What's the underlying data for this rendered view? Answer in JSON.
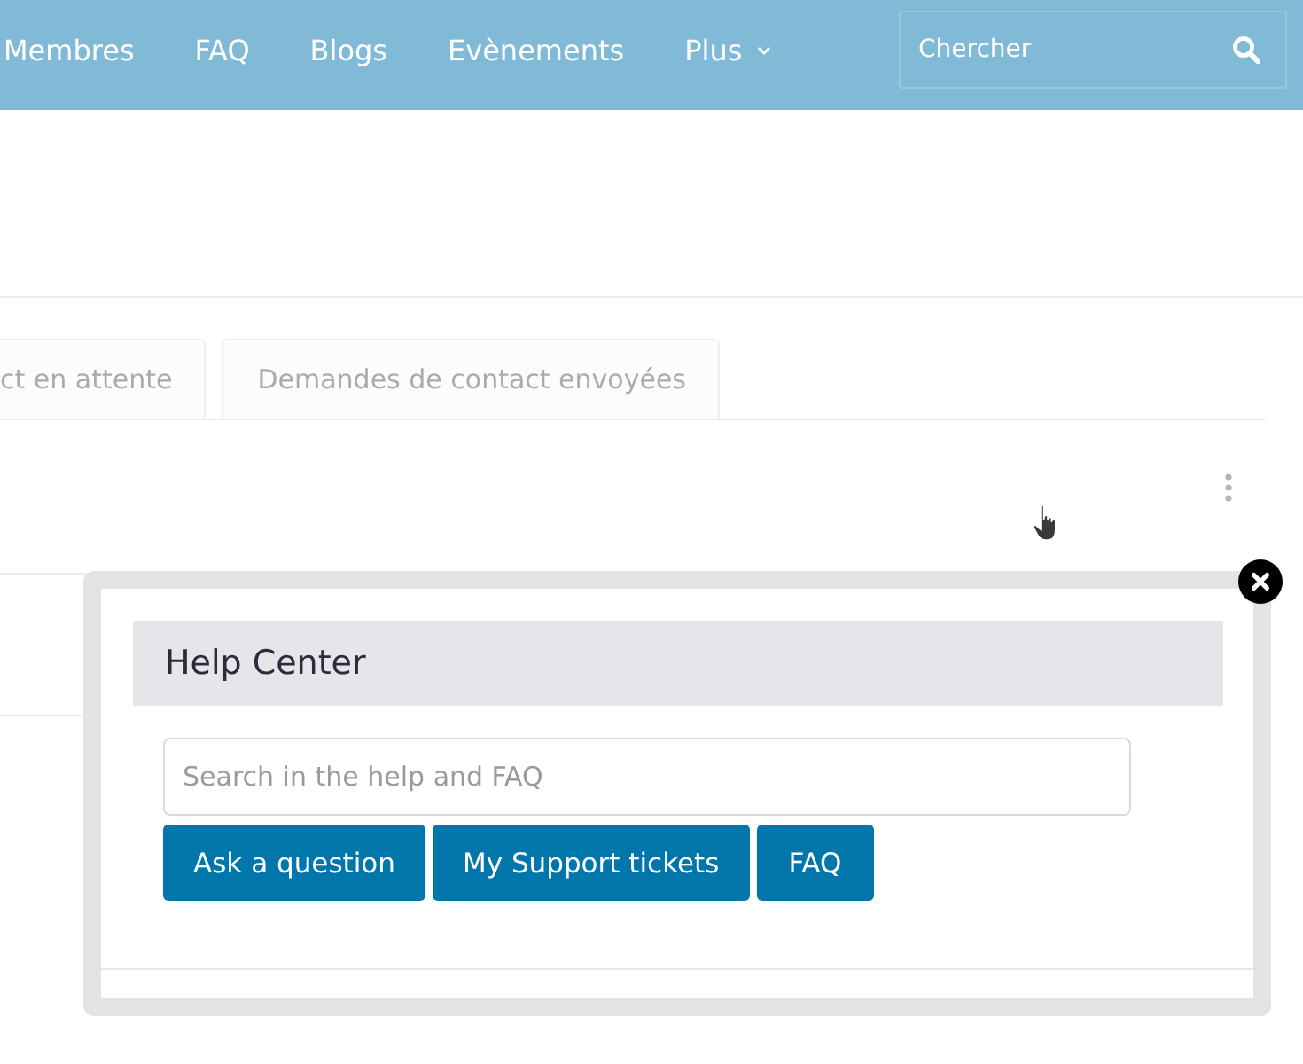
{
  "nav": {
    "items": [
      {
        "label": "Membres",
        "dropdown": false
      },
      {
        "label": "FAQ",
        "dropdown": false
      },
      {
        "label": "Blogs",
        "dropdown": false
      },
      {
        "label": "Evènements",
        "dropdown": false
      },
      {
        "label": "Plus",
        "dropdown": true
      }
    ],
    "search": {
      "placeholder": "Chercher"
    }
  },
  "tabs": [
    {
      "label": "ct en attente",
      "selected": false
    },
    {
      "label": "Demandes de contact envoyées",
      "selected": false
    }
  ],
  "help_center": {
    "title": "Help Center",
    "search": {
      "placeholder": "Search in the help and FAQ"
    },
    "buttons": [
      "Ask a question",
      "My Support tickets",
      "FAQ"
    ]
  }
}
